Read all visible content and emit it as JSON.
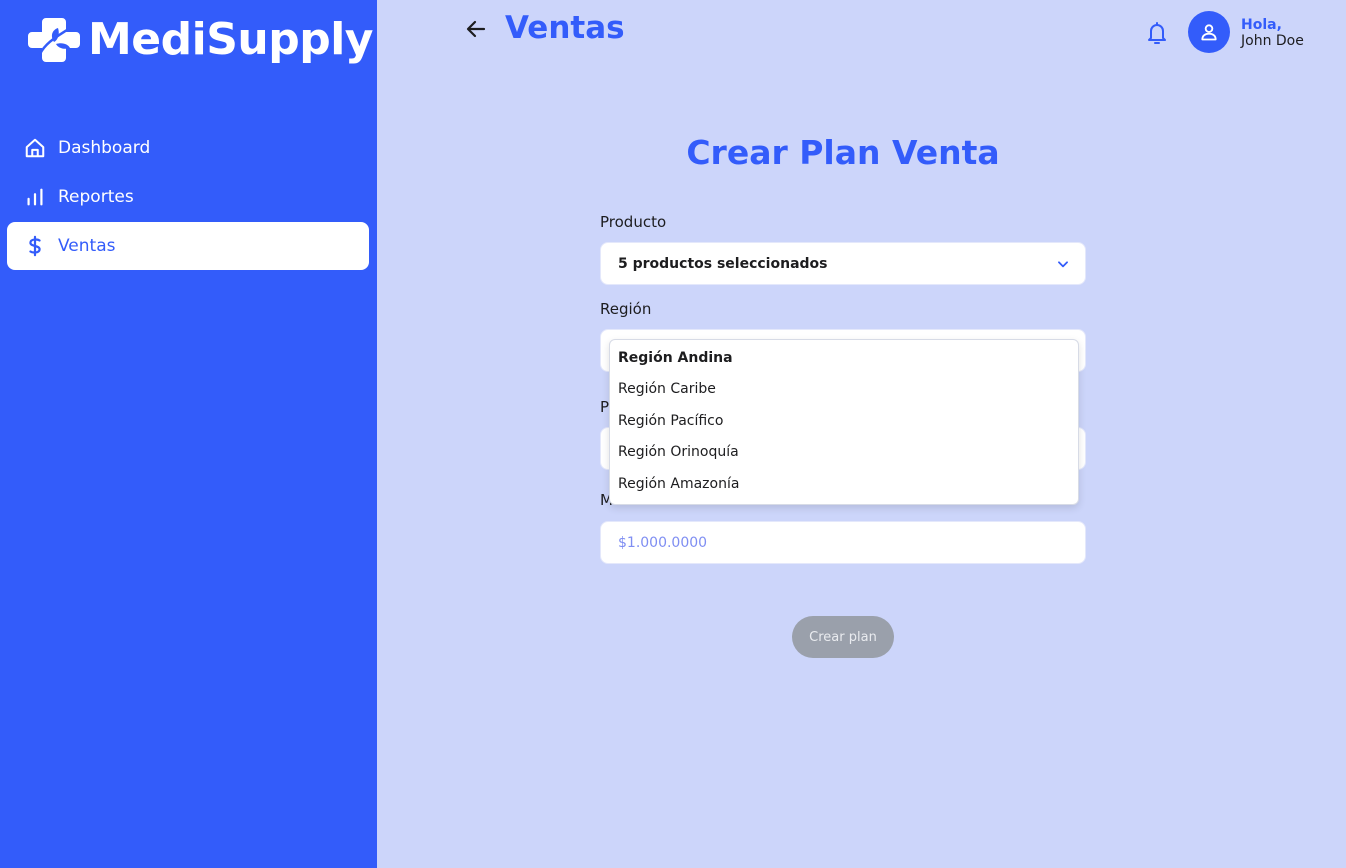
{
  "brand": {
    "name": "MediSupply"
  },
  "sidebar": {
    "items": [
      {
        "label": "Dashboard",
        "icon": "home-icon",
        "active": false
      },
      {
        "label": "Reportes",
        "icon": "bar-chart-icon",
        "active": false
      },
      {
        "label": "Ventas",
        "icon": "dollar-icon",
        "active": true
      }
    ]
  },
  "header": {
    "title": "Ventas",
    "greeting": "Hola,",
    "user_name": "John Doe"
  },
  "form": {
    "title": "Crear Plan Venta",
    "product": {
      "label": "Producto",
      "value": "5 productos seleccionados"
    },
    "region": {
      "label": "Región",
      "options": [
        "Región Andina",
        "Región Caribe",
        "Región Pacífico",
        "Región Orinoquía",
        "Región Amazonía"
      ],
      "highlighted": "Región Andina"
    },
    "third_field": {
      "label_partial": "P"
    },
    "amount": {
      "label_partial": "M",
      "placeholder": "$1.000.0000"
    },
    "submit_label": "Crear plan"
  },
  "colors": {
    "primary": "#335cfa",
    "background": "#ccd5fa",
    "disabled": "#9aa0ab"
  }
}
